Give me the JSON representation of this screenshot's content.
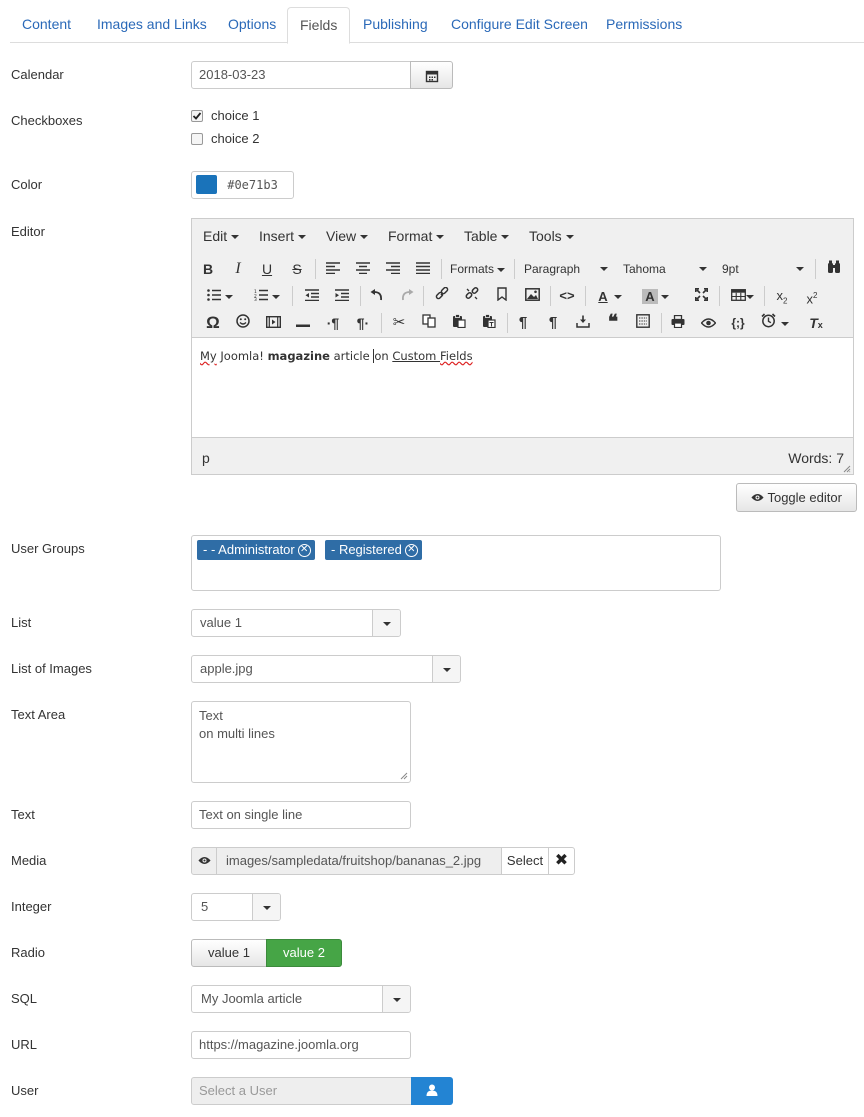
{
  "tabs": [
    "Content",
    "Images and Links",
    "Options",
    "Fields",
    "Publishing",
    "Configure Edit Screen",
    "Permissions"
  ],
  "active_tab": "Fields",
  "fields": {
    "calendar": {
      "label": "Calendar",
      "value": "2018-03-23",
      "icon": "calendar-icon"
    },
    "checkboxes": {
      "label": "Checkboxes",
      "options": [
        {
          "label": "choice 1",
          "checked": true
        },
        {
          "label": "choice 2",
          "checked": false
        }
      ]
    },
    "color": {
      "label": "Color",
      "value": "#0e71b3",
      "swatch": "#1a73ba"
    },
    "editor": {
      "label": "Editor",
      "menus": [
        "Edit",
        "Insert",
        "View",
        "Format",
        "Table",
        "Tools"
      ],
      "formats_label": "Formats",
      "block_format": "Paragraph",
      "font_family": "Tahoma",
      "font_size": "9pt",
      "content": {
        "t1": "My",
        "t2": " Joomla! ",
        "t3": "magazine",
        "t4": " article ",
        "t5": "on ",
        "t6": "Custom ",
        "t7": "Fields"
      },
      "path": "p",
      "word_count": "Words: 7"
    },
    "toggle_editor": "Toggle editor",
    "user_groups": {
      "label": "User Groups",
      "tags": [
        "- - Administrator",
        "- Registered"
      ],
      "tag_color": "#2f6da6"
    },
    "list": {
      "label": "List",
      "value": "value 1"
    },
    "list_images": {
      "label": "List of Images",
      "value": "apple.jpg"
    },
    "textarea": {
      "label": "Text Area",
      "lines": [
        "Text",
        "on multi lines"
      ]
    },
    "text": {
      "label": "Text",
      "value": "Text on single line"
    },
    "media": {
      "label": "Media",
      "value": "images/sampledata/fruitshop/bananas_2.jpg",
      "select_label": "Select"
    },
    "integer": {
      "label": "Integer",
      "value": "5"
    },
    "radio": {
      "label": "Radio",
      "options": [
        "value 1",
        "value 2"
      ],
      "selected": "value 2",
      "selected_color": "#46a546"
    },
    "sql": {
      "label": "SQL",
      "value": "My Joomla article"
    },
    "url": {
      "label": "URL",
      "value": "https://magazine.joomla.org"
    },
    "user": {
      "label": "User",
      "placeholder": "Select a User",
      "button_color": "#2384d3"
    }
  }
}
